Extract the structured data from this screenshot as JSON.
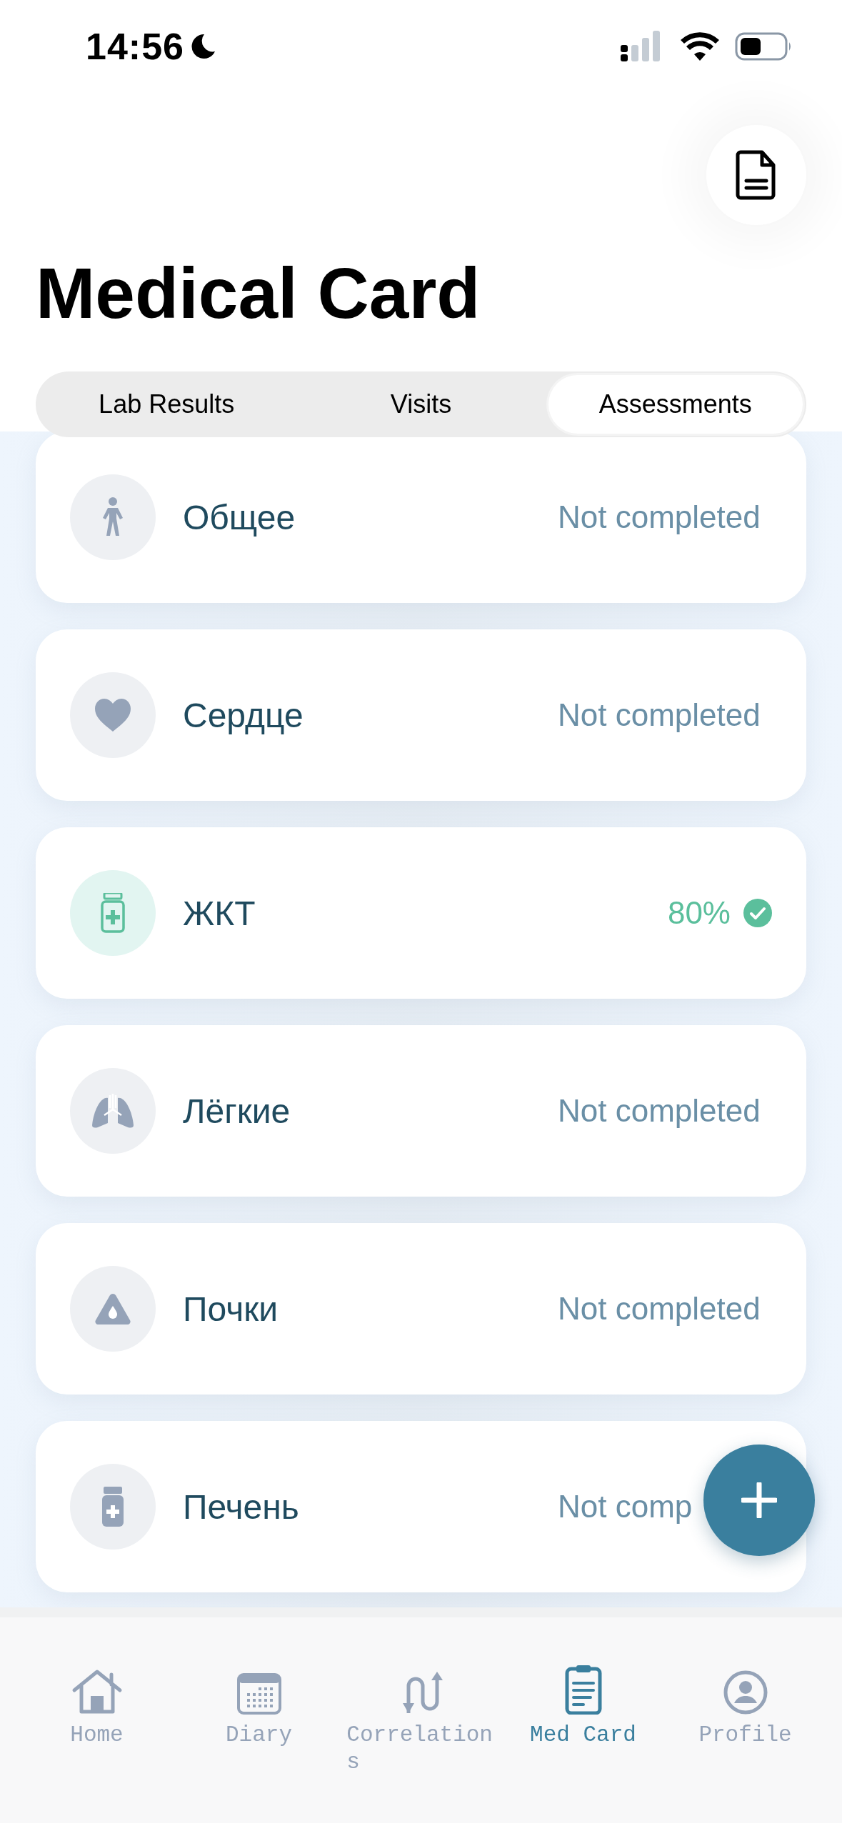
{
  "status_bar": {
    "time": "14:56"
  },
  "header": {
    "title": "Medical Card"
  },
  "tabs": [
    {
      "label": "Lab Results",
      "selected": false
    },
    {
      "label": "Visits",
      "selected": false
    },
    {
      "label": "Assessments",
      "selected": true
    }
  ],
  "assessments": [
    {
      "name": "Общее",
      "status": "Not completed",
      "completed": false
    },
    {
      "name": "Сердце",
      "status": "Not completed",
      "completed": false
    },
    {
      "name": "ЖКТ",
      "status": "80%",
      "completed": true
    },
    {
      "name": "Лёгкие",
      "status": "Not completed",
      "completed": false
    },
    {
      "name": "Почки",
      "status": "Not completed",
      "completed": false
    },
    {
      "name": "Печень",
      "status": "Not comp",
      "completed": false
    }
  ],
  "tab_bar": [
    {
      "label": "Home",
      "selected": false
    },
    {
      "label": "Diary",
      "selected": false
    },
    {
      "label": "Correlations",
      "selected": false
    },
    {
      "label": "Med Card",
      "selected": true
    },
    {
      "label": "Profile",
      "selected": false
    }
  ]
}
